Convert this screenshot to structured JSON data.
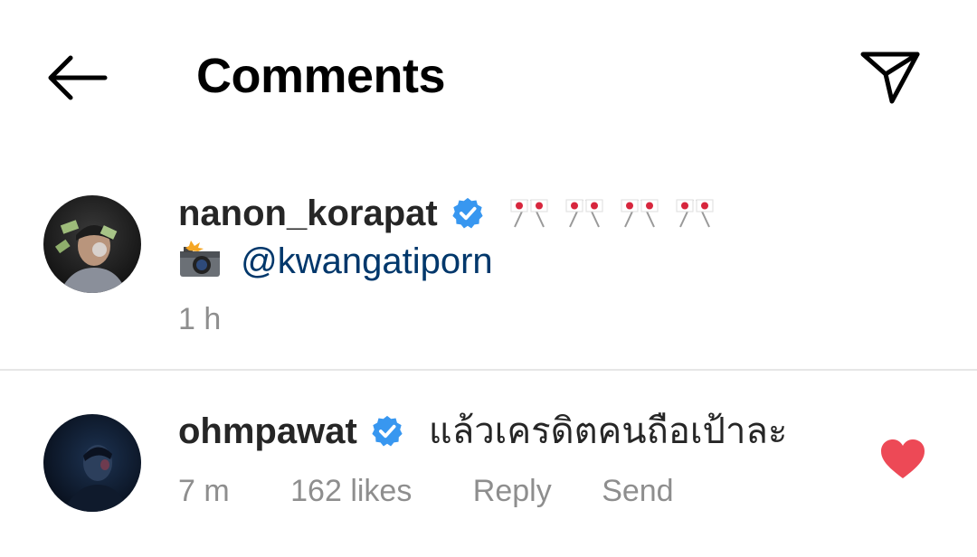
{
  "header": {
    "title": "Comments",
    "back_icon": "arrow-left-icon",
    "share_icon": "paper-plane-icon"
  },
  "comments": [
    {
      "username": "nanon_korapat",
      "verified": true,
      "emoji_text": "🎌🎌🎌🎌",
      "camera_emoji": "📸",
      "mention": "@kwangatiporn",
      "time": "1 h"
    },
    {
      "username": "ohmpawat",
      "verified": true,
      "text": "แล้วเครดิตคนถือเป้าละ",
      "time": "7 m",
      "likes": "162 likes",
      "reply_label": "Reply",
      "send_label": "Send",
      "liked": true
    }
  ],
  "colors": {
    "verified_blue": "#3897f0",
    "heart_red": "#ed4956",
    "mention_blue": "#00376b",
    "meta_gray": "#8e8e8e"
  }
}
